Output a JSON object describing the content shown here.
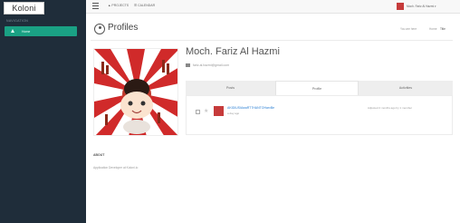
{
  "app": {
    "logo_text": "Koloni"
  },
  "sidebar": {
    "heading": "NAVIGATION",
    "items": [
      {
        "label": "Home",
        "icon": "home-icon"
      }
    ]
  },
  "topbar": {
    "links": [
      "▲ PROJECTS",
      "☰ CALENDAR"
    ],
    "user": "Moch. Fariz Al Hazmi ▾"
  },
  "page": {
    "title": "Profiles",
    "breadcrumb": [
      "You are here",
      "Home",
      "Title"
    ]
  },
  "profile": {
    "name": "Moch. Fariz Al Hazmi",
    "email": "fariz.al.hazmi@gmail.com",
    "about_heading": "ABOUT",
    "about_text": "Application Developer at Koloni.io"
  },
  "tabs": [
    {
      "label": "Posts",
      "active": false
    },
    {
      "label": "Profile",
      "active": true
    },
    {
      "label": "Activities",
      "active": false
    }
  ],
  "repo": {
    "name": "AKIDIUSIAwaRT7HANTOHarvBe",
    "sub": "a day ago",
    "meta": "Adjusted 2 months ago by 1 member"
  },
  "colors": {
    "sidebar": "#1f2d3a",
    "accent": "#1aa184",
    "link": "#2a7fd4"
  }
}
